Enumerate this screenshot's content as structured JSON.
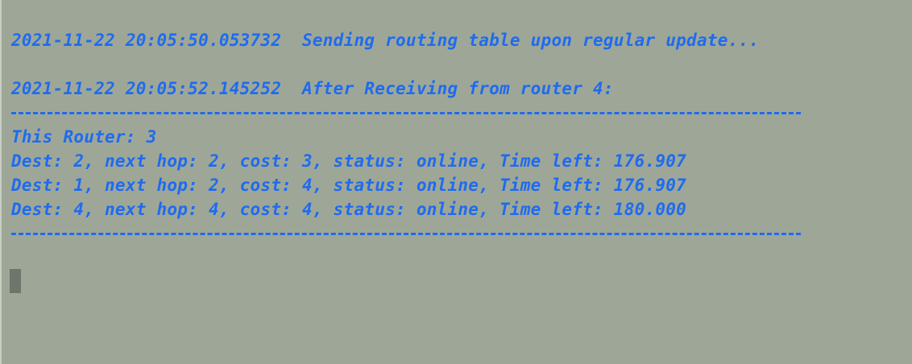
{
  "terminal": {
    "lines": {
      "sending": "2021-11-22 20:05:50.053732  Sending routing table upon regular update...",
      "after_receiving": "2021-11-22 20:05:52.145252  After Receiving from router 4:",
      "this_router": "This Router: 3",
      "routes": [
        "Dest: 2, next hop: 2, cost: 3, status: online, Time left: 176.907",
        "Dest: 1, next hop: 2, cost: 4, status: online, Time left: 176.907",
        "Dest: 4, next hop: 4, cost: 4, status: online, Time left: 180.000"
      ]
    }
  },
  "colors": {
    "background": "#9ea797",
    "text": "#1f6bf0",
    "cursor": "#6e756b"
  }
}
